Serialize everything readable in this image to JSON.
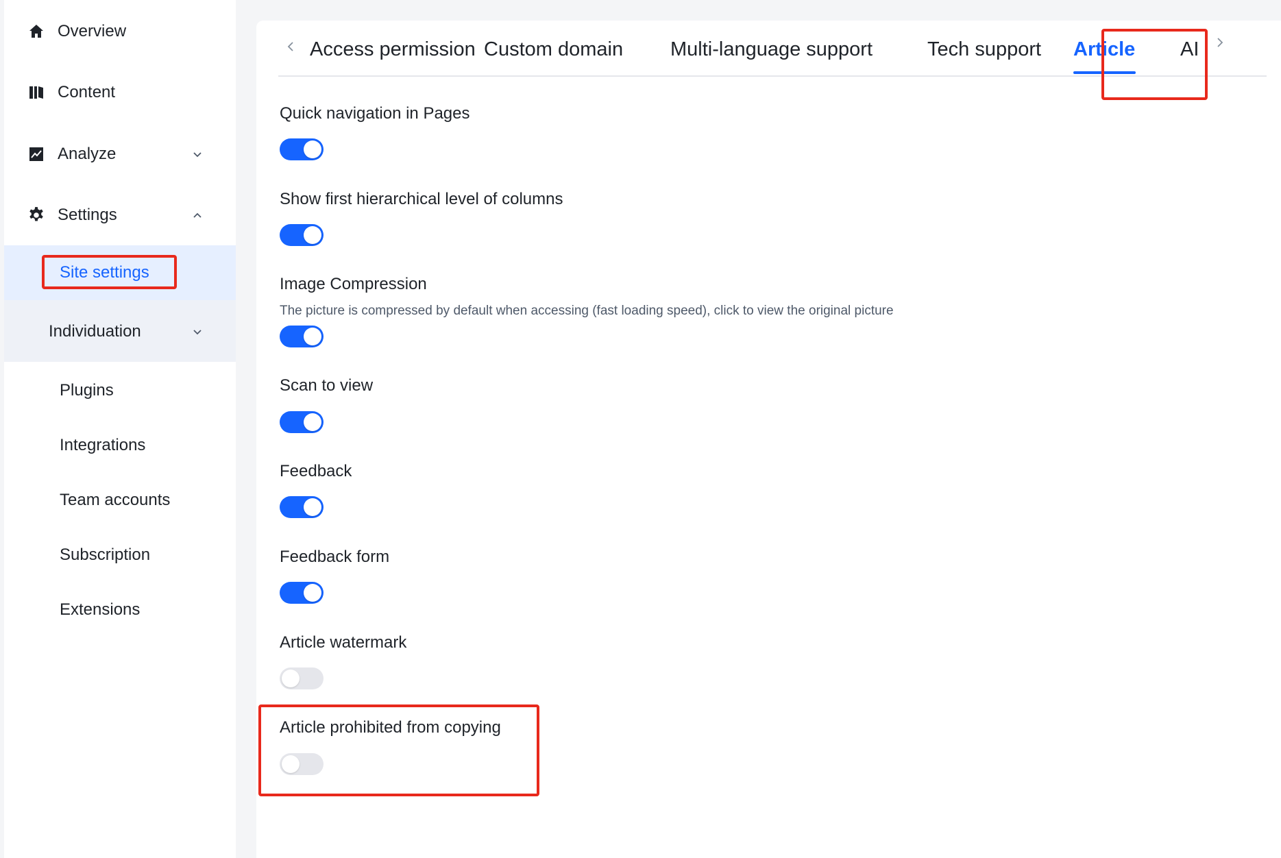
{
  "sidebar": {
    "items": [
      {
        "label": "Overview",
        "icon": "home-icon"
      },
      {
        "label": "Content",
        "icon": "book-icon"
      },
      {
        "label": "Analyze",
        "icon": "chart-icon",
        "expanded": false
      },
      {
        "label": "Settings",
        "icon": "gear-icon",
        "expanded": true
      }
    ],
    "settings_children": {
      "site_settings": "Site settings",
      "individuation": "Individuation",
      "plugins": "Plugins",
      "integrations": "Integrations",
      "team_accounts": "Team accounts",
      "subscription": "Subscription",
      "extensions": "Extensions"
    },
    "active_item": "Site settings"
  },
  "tabs": {
    "items": [
      "Access permission",
      "Custom domain",
      "Multi-language support",
      "Tech support",
      "Article",
      "AI"
    ],
    "active": "Article"
  },
  "settings": [
    {
      "title": "Quick navigation in Pages",
      "enabled": true
    },
    {
      "title": "Show first hierarchical level of columns",
      "enabled": true
    },
    {
      "title": "Image Compression",
      "description": "The picture is compressed by default when accessing (fast loading speed), click to view the original picture",
      "enabled": true
    },
    {
      "title": "Scan to view",
      "enabled": true
    },
    {
      "title": "Feedback",
      "enabled": true
    },
    {
      "title": "Feedback form",
      "enabled": true
    },
    {
      "title": "Article watermark",
      "enabled": false
    },
    {
      "title": "Article prohibited from copying",
      "enabled": false
    }
  ],
  "colors": {
    "accent": "#1664ff",
    "highlight": "#e8291c",
    "toggle_off": "#e5e6eb"
  }
}
